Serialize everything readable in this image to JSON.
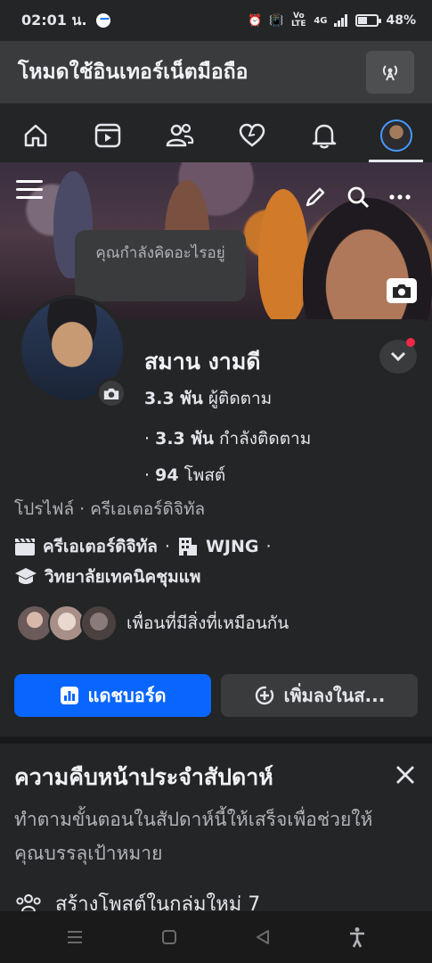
{
  "status_bar": {
    "time": "02:01 น.",
    "network": "4G",
    "volte": "Vo LTE",
    "battery_percent": "48%",
    "battery_level": 0.48
  },
  "mode_bar": {
    "title": "โหมดใช้อินเทอร์เน็ตมือถือ"
  },
  "nav_tabs": [
    "home-icon",
    "video-icon",
    "friends-icon",
    "dating-icon",
    "bell-icon",
    "profile-avatar"
  ],
  "cover": {
    "composer_prompt": "คุณกำลังคิดอะไรอยู่"
  },
  "profile": {
    "name": "สมาน งามดี",
    "followers_count": "3.3 พัน",
    "followers_label": "ผู้ติดตาม",
    "following_count": "3.3 พัน",
    "following_label": "กำลังติดตาม",
    "posts_count": "94",
    "posts_label": "โพสต์",
    "subtitle": "โปรไฟล์ · ครีเอเตอร์ดิจิทัล",
    "category": "ครีเอเตอร์ดิจิทัล",
    "workplace": "WJNG",
    "education": "วิทยาลัยเทคนิคชุมแพ",
    "mutual_text": "เพื่อนที่มีสิ่งที่เหมือนกัน"
  },
  "buttons": {
    "dashboard": "แดชบอร์ด",
    "add_story": "เพิ่มลงในส..."
  },
  "weekly": {
    "title": "ความคืบหน้าประจำสัปดาห์",
    "description": "ทำตามขั้นตอนในสัปดาห์นี้ให้เสร็จเพื่อช่วยให้คุณบรรลุเป้าหมาย",
    "task": "สร้างโพสต์ในกลุ่มใหม่ 7"
  },
  "colors": {
    "accent": "#0866ff",
    "background": "#242526",
    "notification_dot": "#f02849"
  }
}
